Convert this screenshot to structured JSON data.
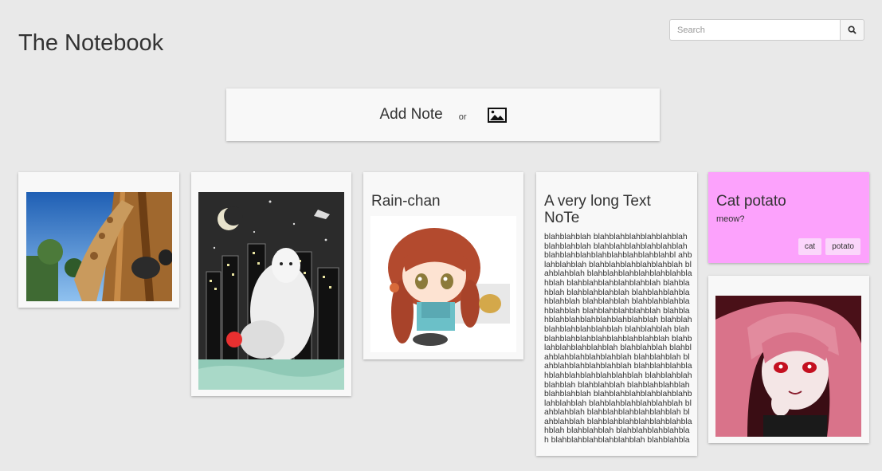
{
  "app": {
    "title": "The Notebook"
  },
  "search": {
    "placeholder": "Search",
    "button_icon": "search-icon"
  },
  "add_bar": {
    "add_note_label": "Add Note",
    "or_label": "or",
    "image_icon": "image-icon"
  },
  "notes": [
    {
      "type": "image",
      "image": "giraffe photo"
    },
    {
      "type": "image",
      "image": "ink illustration of a mouse, cat and city at night"
    },
    {
      "type": "text-image",
      "title": "Rain-chan",
      "image": "chibi anime girl with red hair"
    },
    {
      "type": "text",
      "title": "A very long Text NoTe",
      "body": "blahblahblah blahblahblahblahblahblah blahblahblah blahblahblahblahblahblah blahblahblahblahblahblahblahblahbl ahblahblahblah blahblahblahblahblahblah blahblahblah blahblahblahblahblahblahblahblah blahblahblahblahblahblah blahblahblah blahblahblahblah blahblahblahblahblahblah blahblahblah blahblahblahblahblahblah blahblahblahblahblah blahblahblahblahblahblahblahblahblah blahblahblahblahblahblahblah blahblahblah blahblahblahblahblahblahblahblahblah blahblahblahblahblahblah blahblahblah blahblahblahblahblahblahblah blahblahblah blahblahblahblahblahblah blahblahblahblahblahblahblahblahblahblah blahblahblahblahblah blahblahblah blahblahblahblahblahblahblah blahblahblahblahblahblahblahblahblah blahblahblahblahblahblah blahblahblah blahblahblahblahblahblah blahblahblah blahblahblahblahblahblahblahblah blahblahblah blahblahblahblahblah blahblahblahblahblahblah blahblahblahblahblahblahblahblahblah"
    },
    {
      "type": "text",
      "title": "Cat potato",
      "body": "meow?",
      "tags": [
        "cat",
        "potato"
      ],
      "color": "#fca2fc"
    },
    {
      "type": "image",
      "image": "anime girl with pink hair and red eyes"
    }
  ],
  "colors": {
    "background": "#e9e9e9",
    "card": "#f8f8f8",
    "pink_note": "#fca2fc",
    "tag": "#fbd6fb"
  }
}
